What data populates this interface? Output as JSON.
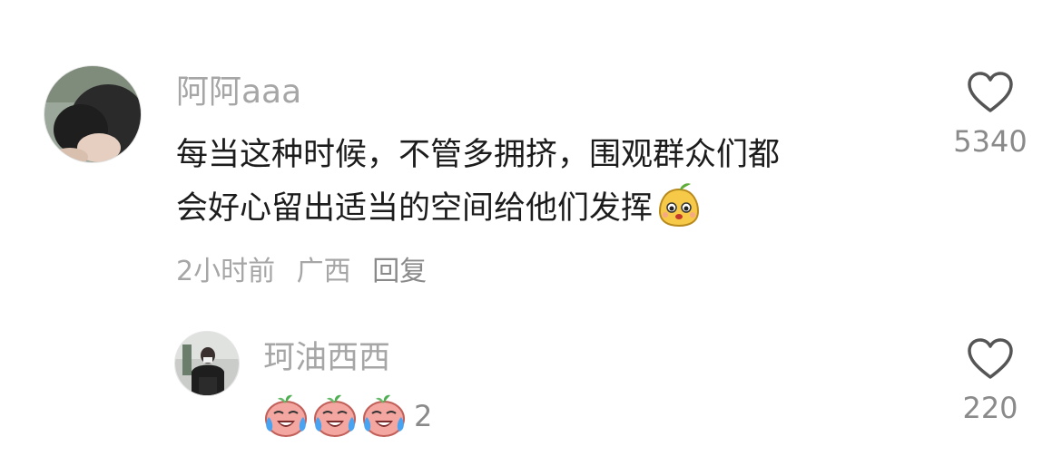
{
  "comments": [
    {
      "username": "阿阿aaa",
      "text_lines": [
        "每当这种时候，不管多拥挤，围观群众们都",
        "会好心留出适当的空间给他们发挥"
      ],
      "inline_emoji": "pear-face-emoji",
      "time": "2小时前",
      "location": "广西",
      "reply_label": "回复",
      "likes": "5340"
    },
    {
      "username": "珂油西西",
      "emojis": [
        "crying-laugh-emoji",
        "crying-laugh-emoji",
        "crying-laugh-emoji"
      ],
      "trailing_text": "2",
      "likes": "220"
    }
  ],
  "colors": {
    "name": "#a6a6a6",
    "text": "#1c1c1c",
    "count": "#8a8a8a"
  },
  "icons": {
    "like": "heart-outline-icon"
  }
}
